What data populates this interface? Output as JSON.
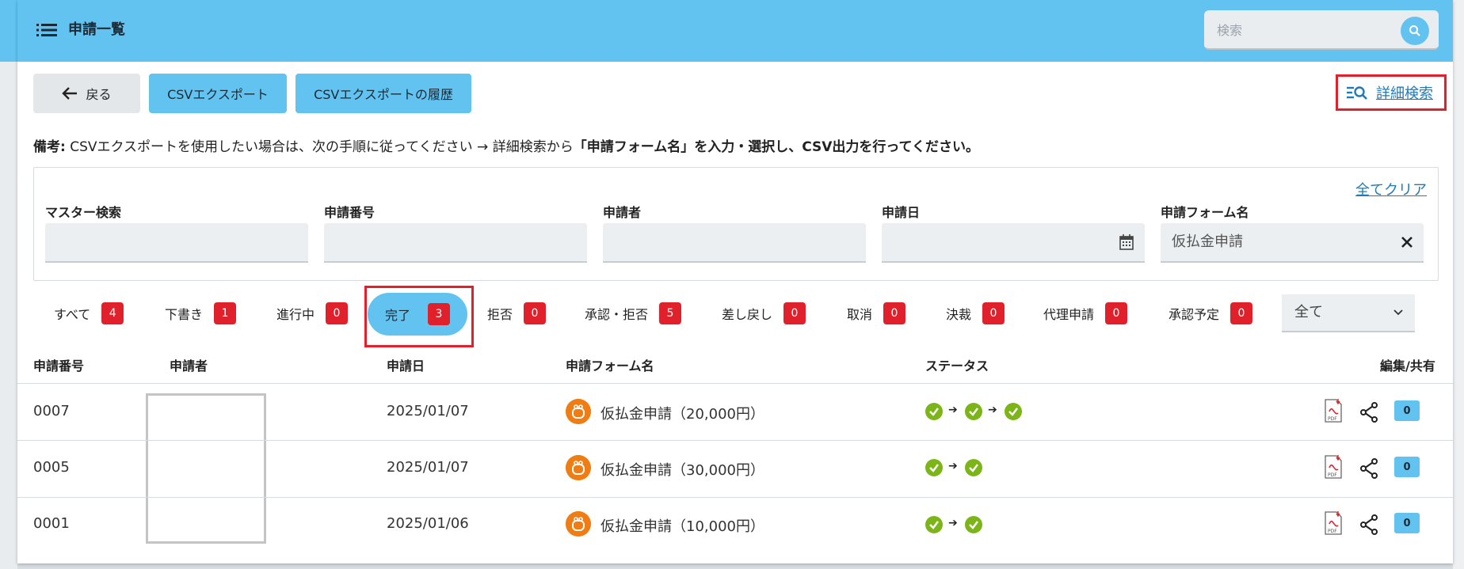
{
  "header": {
    "title": "申請一覧",
    "search_placeholder": "検索"
  },
  "toolbar": {
    "back_label": "戻る",
    "csv_export_label": "CSVエクスポート",
    "csv_history_label": "CSVエクスポートの履歴",
    "detail_search_label": "詳細検索"
  },
  "note": {
    "prefix": "備考:",
    "text": "CSVエクスポートを使用したい場合は、次の手順に従ってください → 詳細検索から",
    "bold": "「申請フォーム名」を入力・選択し、CSV出力を行ってください。"
  },
  "filters": {
    "clear_all_label": "全てクリア",
    "fields": [
      {
        "label": "マスター検索",
        "value": ""
      },
      {
        "label": "申請番号",
        "value": ""
      },
      {
        "label": "申請者",
        "value": ""
      },
      {
        "label": "申請日",
        "value": ""
      },
      {
        "label": "申請フォーム名",
        "value": "仮払金申請"
      }
    ]
  },
  "status_tabs": [
    {
      "label": "すべて",
      "count": "4"
    },
    {
      "label": "下書き",
      "count": "1"
    },
    {
      "label": "進行中",
      "count": "0"
    },
    {
      "label": "完了",
      "count": "3",
      "active": true
    },
    {
      "label": "拒否",
      "count": "0"
    },
    {
      "label": "承認・拒否",
      "count": "5"
    },
    {
      "label": "差し戻し",
      "count": "0"
    },
    {
      "label": "取消",
      "count": "0"
    },
    {
      "label": "決裁",
      "count": "0"
    },
    {
      "label": "代理申請",
      "count": "0"
    },
    {
      "label": "承認予定",
      "count": "0"
    }
  ],
  "scope_select": {
    "value": "全て"
  },
  "table": {
    "columns": [
      "申請番号",
      "申請者",
      "申請日",
      "申請フォーム名",
      "ステータス",
      "編集/共有"
    ],
    "rows": [
      {
        "number": "0007",
        "date": "2025/01/07",
        "form": "仮払金申請（20,000円）",
        "steps": 3,
        "comments": "0"
      },
      {
        "number": "0005",
        "date": "2025/01/07",
        "form": "仮払金申請（30,000円）",
        "steps": 2,
        "comments": "0"
      },
      {
        "number": "0001",
        "date": "2025/01/06",
        "form": "仮払金申請（10,000円）",
        "steps": 2,
        "comments": "0"
      }
    ]
  },
  "colors": {
    "accent": "#62c3f1",
    "badge": "#e0202a",
    "link": "#1e7bb8",
    "check": "#7cb518",
    "form_icon": "#ef7d13"
  },
  "icons": {
    "menu": "menu-icon",
    "search": "search-icon",
    "back": "arrow-left-icon",
    "detail_search": "filter-search-icon",
    "calendar": "calendar-icon",
    "clear": "close-icon",
    "chevron": "chevron-down-icon",
    "pdf": "pdf-icon",
    "share": "share-icon",
    "comment": "comment-icon",
    "status_done": "check-circle-icon",
    "form": "purse-icon"
  }
}
